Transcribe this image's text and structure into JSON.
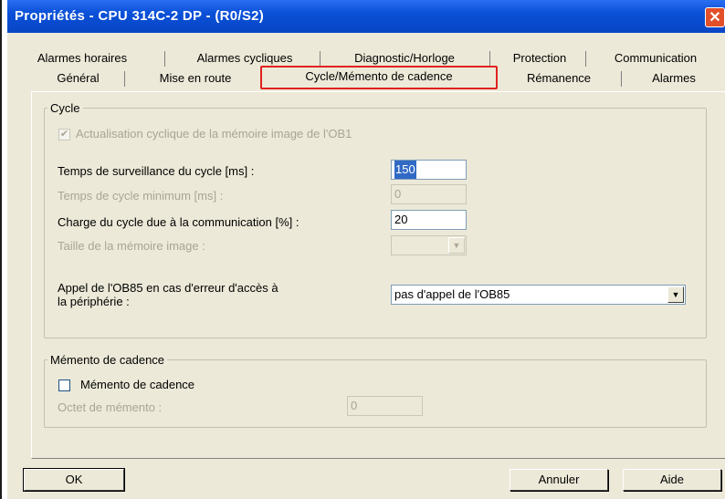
{
  "window": {
    "title": "Propriétés - CPU 314C-2 DP - (R0/S2)",
    "close_label": "✕"
  },
  "tabs": {
    "row1": [
      "Alarmes horaires",
      "Alarmes cycliques",
      "Diagnostic/Horloge",
      "Protection",
      "Communication"
    ],
    "row2": [
      "Général",
      "Mise en route",
      "Cycle/Mémento de cadence",
      "Rémanence",
      "Alarmes"
    ],
    "active": "Cycle/Mémento de cadence"
  },
  "cycle": {
    "group_title": "Cycle",
    "oblcheck_label": "Actualisation cyclique de la mémoire image de l'OB1",
    "oblcheck_checked": true,
    "oblcheck_mark": "✔",
    "surv_label": "Temps de surveillance du cycle [ms] :",
    "surv_value": "150",
    "min_label": "Temps de cycle minimum [ms] :",
    "min_value": "0",
    "charge_label": "Charge du cycle due à la communication [%] :",
    "charge_value": "20",
    "taille_label": "Taille de la mémoire image :",
    "taille_value": "",
    "ob85_label_line1": "Appel de l'OB85 en cas d'erreur d'accès à",
    "ob85_label_line2": "la périphérie :",
    "ob85_value": "pas d'appel de l'OB85",
    "dropdown_arrow": "▼"
  },
  "memento": {
    "group_title": "Mémento de cadence",
    "check_label": "Mémento de cadence",
    "check_checked": false,
    "octet_label": "Octet de mémento :",
    "octet_value": "0"
  },
  "buttons": {
    "ok": "OK",
    "annuler": "Annuler",
    "aide": "Aide"
  },
  "colors": {
    "title_bar": "#0a50d8",
    "highlight": "#e0221f",
    "dialog_bg": "#ece9d8"
  }
}
